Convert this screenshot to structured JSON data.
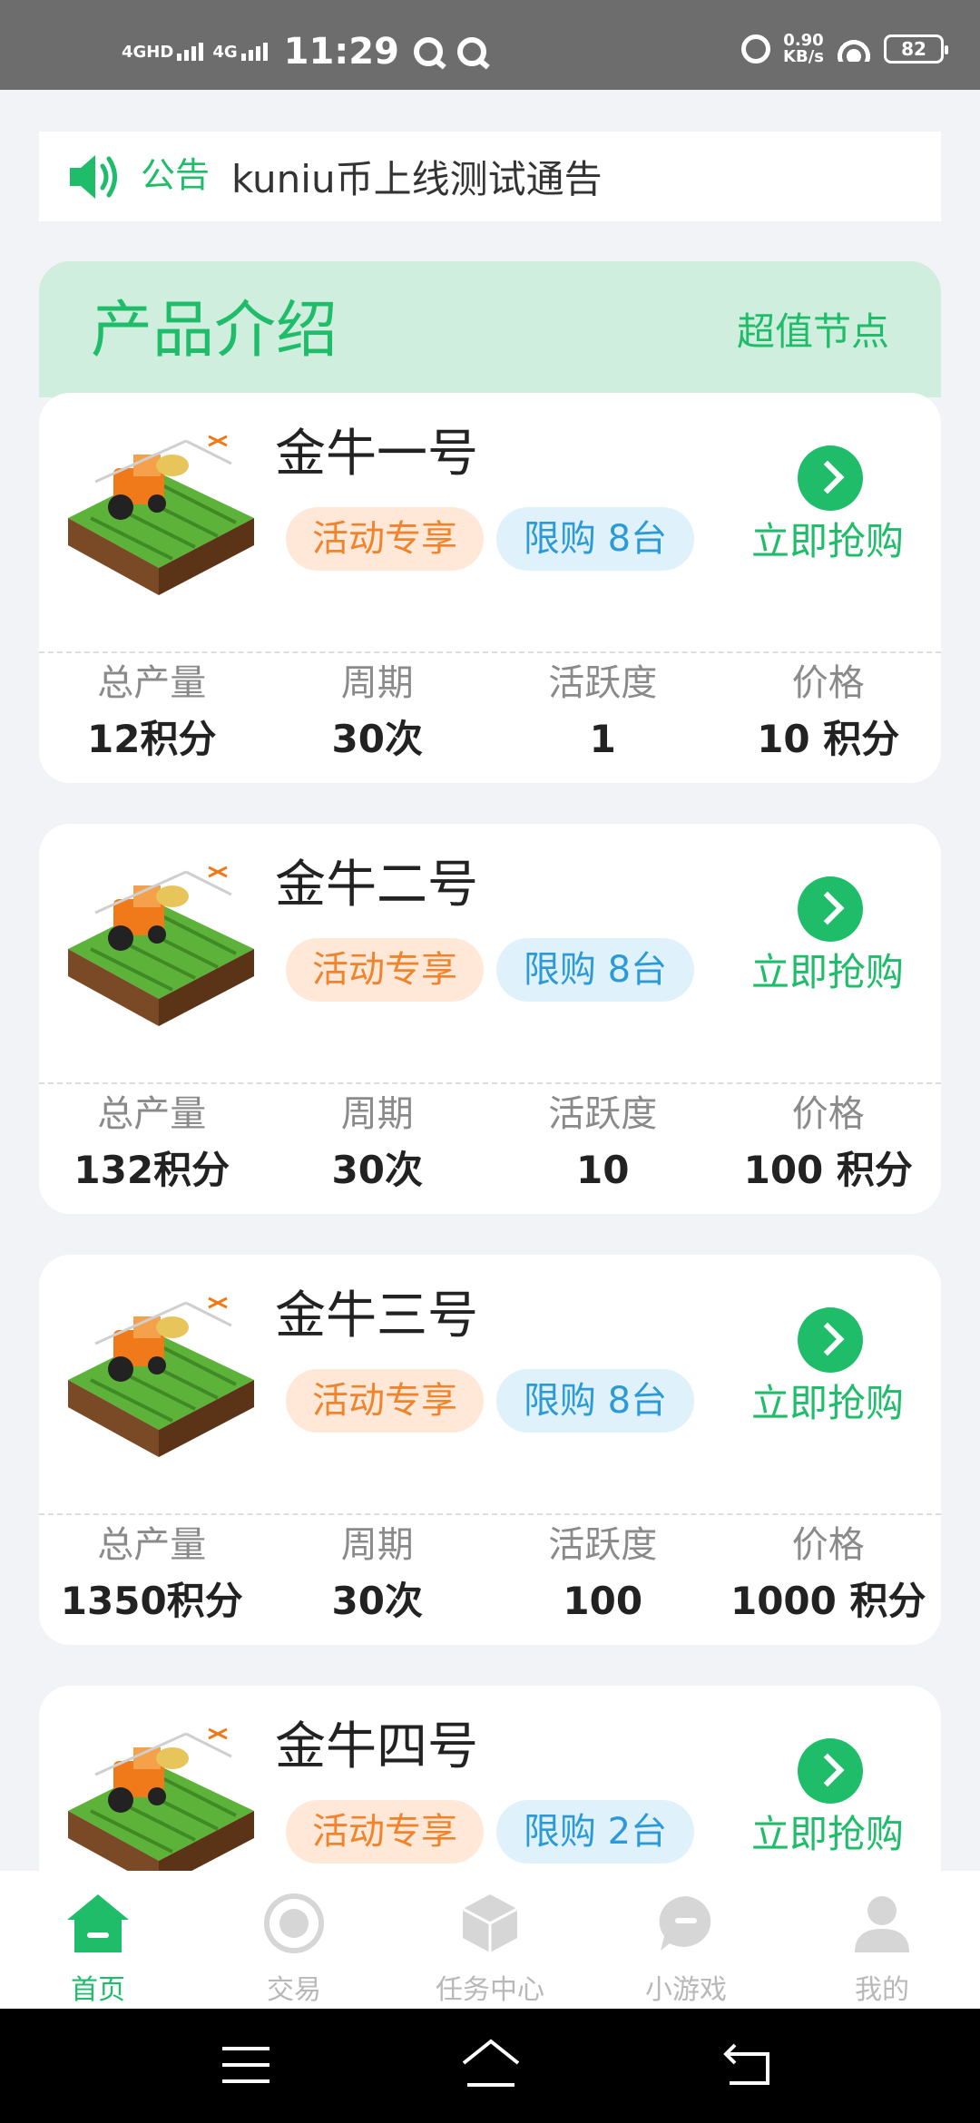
{
  "status": {
    "net1": "4GHD",
    "net2": "4G",
    "time": "11:29",
    "speed_value": "0.90",
    "speed_unit": "KB/s",
    "battery": "82"
  },
  "notice": {
    "label": "公告",
    "text": "kuniu币上线测试通告"
  },
  "intro": {
    "title": "产品介绍",
    "link": "超值节点"
  },
  "stat_labels": [
    "总产量",
    "周期",
    "活跃度",
    "价格"
  ],
  "products": [
    {
      "name": "金牛一号",
      "tag_activity": "活动专享",
      "tag_limit": "限购 8台",
      "buy": "立即抢购",
      "stats": [
        "12积分",
        "30次",
        "1",
        "10 积分"
      ]
    },
    {
      "name": "金牛二号",
      "tag_activity": "活动专享",
      "tag_limit": "限购 8台",
      "buy": "立即抢购",
      "stats": [
        "132积分",
        "30次",
        "10",
        "100 积分"
      ]
    },
    {
      "name": "金牛三号",
      "tag_activity": "活动专享",
      "tag_limit": "限购 8台",
      "buy": "立即抢购",
      "stats": [
        "1350积分",
        "30次",
        "100",
        "1000 积分"
      ]
    },
    {
      "name": "金牛四号",
      "tag_activity": "活动专享",
      "tag_limit": "限购 2台",
      "buy": "立即抢购"
    }
  ],
  "tabs": [
    {
      "label": "首页",
      "icon": "home-icon"
    },
    {
      "label": "交易",
      "icon": "trade-icon"
    },
    {
      "label": "任务中心",
      "icon": "task-center-icon"
    },
    {
      "label": "小游戏",
      "icon": "game-icon"
    },
    {
      "label": "我的",
      "icon": "profile-icon"
    }
  ],
  "colors": {
    "accent": "#1fbd6a",
    "intro_bg": "#cfeedd",
    "tag_activity": "#f0842c",
    "tag_limit": "#2c9ad6"
  }
}
